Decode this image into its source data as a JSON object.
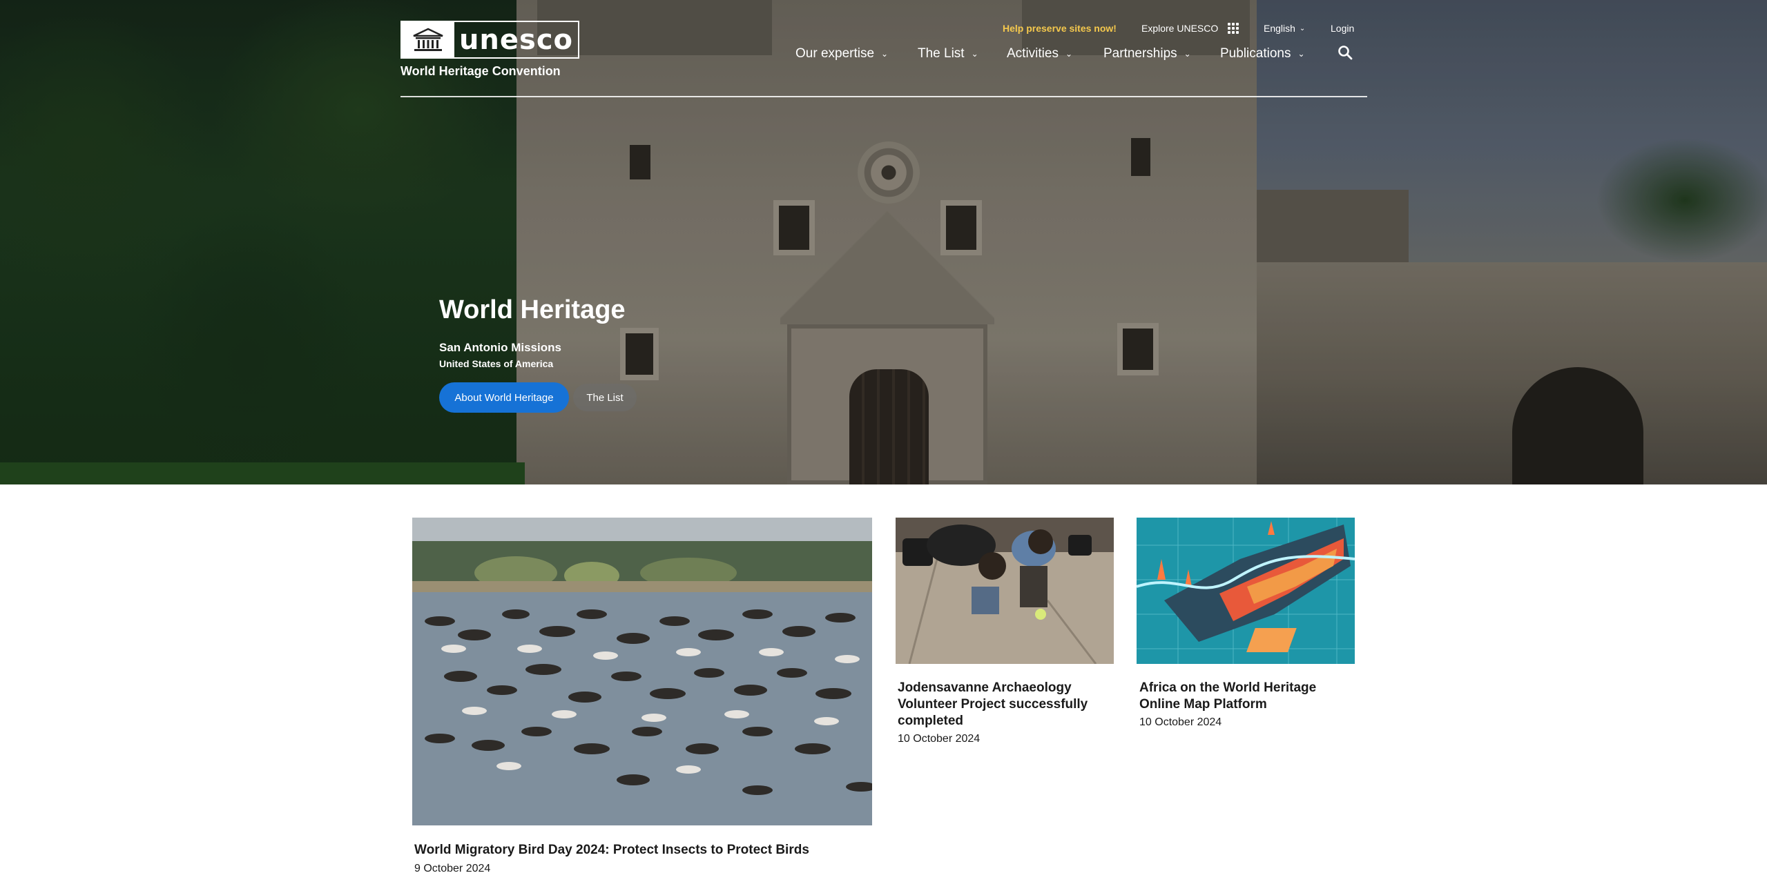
{
  "header": {
    "logo_word": "unesco",
    "logo_subtitle": "World Heritage Convention",
    "utility": {
      "preserve": "Help preserve sites now!",
      "explore": "Explore UNESCO",
      "language": "English",
      "login": "Login"
    },
    "nav": [
      {
        "label": "Our expertise"
      },
      {
        "label": "The List"
      },
      {
        "label": "Activities"
      },
      {
        "label": "Partnerships"
      },
      {
        "label": "Publications"
      }
    ]
  },
  "hero": {
    "title": "World Heritage",
    "site": "San Antonio Missions",
    "country": "United States of America",
    "primary_button": "About World Heritage",
    "secondary_button": "The List"
  },
  "news": [
    {
      "title": "World Migratory Bird Day 2024: Protect Insects to Protect Birds",
      "date": "9 October 2024"
    },
    {
      "title_lines": [
        "Jodensavanne Archaeology",
        "Volunteer Project successfully",
        "completed"
      ],
      "date": "10 October 2024"
    },
    {
      "title_lines": [
        "Africa on the World Heritage",
        "Online Map Platform"
      ],
      "date": "10 October 2024"
    }
  ],
  "colors": {
    "accent": "#1672d6",
    "preserve_link": "#f4c84d"
  },
  "icons": [
    "unesco-emblem-icon",
    "apps-grid-icon",
    "chevron-down-icon",
    "search-icon"
  ]
}
